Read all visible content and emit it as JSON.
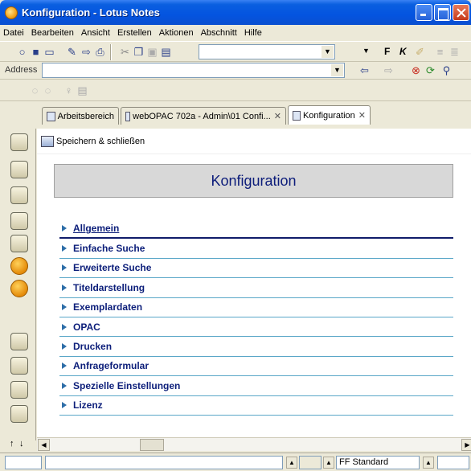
{
  "window": {
    "title": "Konfiguration - Lotus Notes",
    "controls": [
      "minimize",
      "maximize",
      "close"
    ]
  },
  "menu": {
    "items": [
      "Datei",
      "Bearbeiten",
      "Ansicht",
      "Erstellen",
      "Aktionen",
      "Abschnitt",
      "Hilfe"
    ]
  },
  "toolbar": {
    "bold_label": "F",
    "italic_label": "K",
    "address_label": "Address"
  },
  "tabs": [
    {
      "label": "Arbeitsbereich",
      "closable": false
    },
    {
      "label": "webOPAC 702a - Admin\\01 Confi...",
      "closable": true
    },
    {
      "label": "Konfiguration",
      "closable": true,
      "active": true
    }
  ],
  "tab_close_glyph": "✕",
  "document": {
    "action_label": "Speichern & schließen",
    "header_title": "Konfiguration",
    "nav_items": [
      "Allgemein",
      "Einfache Suche",
      "Erweiterte Suche",
      "Titeldarstellung",
      "Exemplardaten",
      "OPAC",
      "Drucken",
      "Anfrageformular",
      "Spezielle Einstellungen",
      "Lizenz"
    ]
  },
  "status": {
    "font_label": "FF Standard"
  },
  "colors": {
    "titlebar": "#0454e0",
    "nav_text": "#0c1e7a",
    "nav_divider": "#5aa7c8",
    "header_bg": "#d8d8d8"
  }
}
